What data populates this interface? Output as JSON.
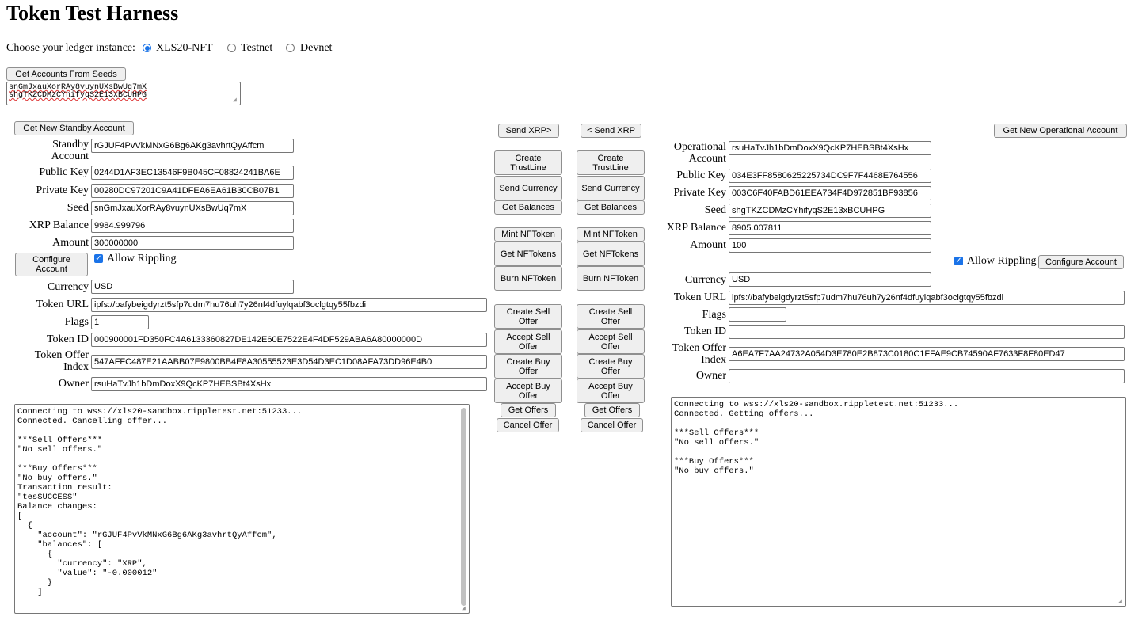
{
  "page_title": "Token Test Harness",
  "ledger": {
    "prompt": "Choose your ledger instance:",
    "options": [
      {
        "label": "XLS20-NFT",
        "selected": true
      },
      {
        "label": "Testnet",
        "selected": false
      },
      {
        "label": "Devnet",
        "selected": false
      }
    ]
  },
  "seeds": {
    "button_label": "Get Accounts From Seeds",
    "line1": "snGmJxauXorRAy8vuynUXsBwUq7mX",
    "line2": "shgTKZCDMzCYhifyqS2E13xBCUHPG"
  },
  "standby": {
    "get_new_button": "Get New Standby Account",
    "account_label": "Standby Account",
    "account": "rGJUF4PvVkMNxG6Bg6AKg3avhrtQyAffcm",
    "public_key_label": "Public Key",
    "public_key": "0244D1AF3EC13546F9B045CF08824241BA6E",
    "private_key_label": "Private Key",
    "private_key": "00280DC97201C9A41DFEA6EA61B30CB07B1",
    "seed_label": "Seed",
    "seed": "snGmJxauXorRAy8vuynUXsBwUq7mX",
    "xrp_balance_label": "XRP Balance",
    "xrp_balance": "9984.999796",
    "amount_label": "Amount",
    "amount": "300000000",
    "configure_button": "Configure Account",
    "allow_rippling_label": "Allow Rippling",
    "currency_label": "Currency",
    "currency": "USD",
    "token_url_label": "Token URL",
    "token_url": "ipfs://bafybeigdyrzt5sfp7udm7hu76uh7y26nf4dfuylqabf3oclgtqy55fbzdi",
    "flags_label": "Flags",
    "flags": "1",
    "token_id_label": "Token ID",
    "token_id": "000900001FD350FC4A6133360827DE142E60E7522E4F4DF529ABA6A80000000D",
    "token_offer_index_label": "Token Offer Index",
    "token_offer_index": "547AFFC487E21AABB07E9800BB4E8A30555523E3D54D3EC1D08AFA73DD96E4B0",
    "owner_label": "Owner",
    "owner": "rsuHaTvJh1bDmDoxX9QcKP7HEBSBt4XsHx",
    "log": "Connecting to wss://xls20-sandbox.rippletest.net:51233...\nConnected. Cancelling offer...\n\n***Sell Offers***\n\"No sell offers.\"\n\n***Buy Offers***\n\"No buy offers.\"\nTransaction result:\n\"tesSUCCESS\"\nBalance changes:\n[\n  {\n    \"account\": \"rGJUF4PvVkMNxG6Bg6AKg3avhrtQyAffcm\",\n    \"balances\": [\n      {\n        \"currency\": \"XRP\",\n        \"value\": \"-0.000012\"\n      }\n    ]"
  },
  "operational": {
    "get_new_button": "Get New Operational Account",
    "account_label": "Operational Account",
    "account": "rsuHaTvJh1bDmDoxX9QcKP7HEBSBt4XsHx",
    "public_key_label": "Public Key",
    "public_key": "034E3FF8580625225734DC9F7F4468E764556",
    "private_key_label": "Private Key",
    "private_key": "003C6F40FABD61EEA734F4D972851BF93856",
    "seed_label": "Seed",
    "seed": "shgTKZCDMzCYhifyqS2E13xBCUHPG",
    "xrp_balance_label": "XRP Balance",
    "xrp_balance": "8905.007811",
    "amount_label": "Amount",
    "amount": "100",
    "allow_rippling_label": "Allow Rippling",
    "configure_button": "Configure Account",
    "currency_label": "Currency",
    "currency": "USD",
    "token_url_label": "Token URL",
    "token_url": "ipfs://bafybeigdyrzt5sfp7udm7hu76uh7y26nf4dfuylqabf3oclgtqy55fbzdi",
    "flags_label": "Flags",
    "flags": "",
    "token_id_label": "Token ID",
    "token_id": "",
    "token_offer_index_label": "Token Offer Index",
    "token_offer_index": "A6EA7F7AA24732A054D3E780E2B873C0180C1FFAE9CB74590AF7633F8F80ED47",
    "owner_label": "Owner",
    "owner": "",
    "log": "Connecting to wss://xls20-sandbox.rippletest.net:51233...\nConnected. Getting offers...\n\n***Sell Offers***\n\"No sell offers.\"\n\n***Buy Offers***\n\"No buy offers.\""
  },
  "center_left": {
    "send_xrp": "Send XRP>",
    "create_trustline": "Create TrustLine",
    "send_currency": "Send Currency",
    "get_balances": "Get Balances",
    "mint_nftoken": "Mint NFToken",
    "get_nftokens": "Get NFTokens",
    "burn_nftoken": "Burn NFToken",
    "create_sell_offer": "Create Sell Offer",
    "accept_sell_offer": "Accept Sell Offer",
    "create_buy_offer": "Create Buy Offer",
    "accept_buy_offer": "Accept Buy Offer",
    "get_offers": "Get Offers",
    "cancel_offer": "Cancel Offer"
  },
  "center_right": {
    "send_xrp": "< Send XRP",
    "create_trustline": "Create TrustLine",
    "send_currency": "Send Currency",
    "get_balances": "Get Balances",
    "mint_nftoken": "Mint NFToken",
    "get_nftokens": "Get NFTokens",
    "burn_nftoken": "Burn NFToken",
    "create_sell_offer": "Create Sell Offer",
    "accept_sell_offer": "Accept Sell Offer",
    "create_buy_offer": "Create Buy Offer",
    "accept_buy_offer": "Accept Buy Offer",
    "get_offers": "Get Offers",
    "cancel_offer": "Cancel Offer"
  }
}
